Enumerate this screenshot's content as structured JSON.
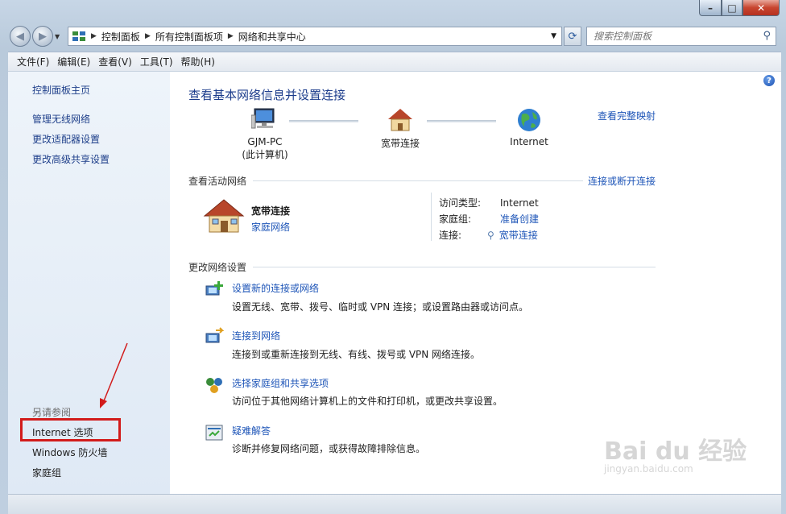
{
  "window": {
    "address": {
      "crumbs": [
        "控制面板",
        "所有控制面板项",
        "网络和共享中心"
      ]
    },
    "search_placeholder": "搜索控制面板"
  },
  "menu": [
    "文件(F)",
    "编辑(E)",
    "查看(V)",
    "工具(T)",
    "帮助(H)"
  ],
  "sidebar": {
    "top_links": [
      "控制面板主页",
      "管理无线网络",
      "更改适配器设置",
      "更改高级共享设置"
    ],
    "see_also_heading": "另请参阅",
    "see_also": [
      "Internet 选项",
      "Windows 防火墙",
      "家庭组"
    ]
  },
  "main": {
    "title": "查看基本网络信息并设置连接",
    "view_full_map": "查看完整映射",
    "nodes": [
      {
        "label": "GJM-PC",
        "sub": "(此计算机)"
      },
      {
        "label": "宽带连接",
        "sub": ""
      },
      {
        "label": "Internet",
        "sub": ""
      }
    ],
    "active": {
      "heading": "查看活动网络",
      "connect_disconnect": "连接或断开连接",
      "name": "宽带连接",
      "type": "家庭网络",
      "access_type_label": "访问类型:",
      "access_type_value": "Internet",
      "homegroup_label": "家庭组:",
      "homegroup_value": "准备创建",
      "connection_label": "连接:",
      "connection_value": "宽带连接"
    },
    "change_heading": "更改网络设置",
    "tasks": [
      {
        "title": "设置新的连接或网络",
        "desc": "设置无线、宽带、拨号、临时或 VPN 连接；或设置路由器或访问点。"
      },
      {
        "title": "连接到网络",
        "desc": "连接到或重新连接到无线、有线、拨号或 VPN 网络连接。"
      },
      {
        "title": "选择家庭组和共享选项",
        "desc": "访问位于其他网络计算机上的文件和打印机，或更改共享设置。"
      },
      {
        "title": "疑难解答",
        "desc": "诊断并修复网络问题，或获得故障排除信息。"
      }
    ]
  },
  "watermark": {
    "main": "Bai du 经验",
    "sub": "jingyan.baidu.com"
  }
}
